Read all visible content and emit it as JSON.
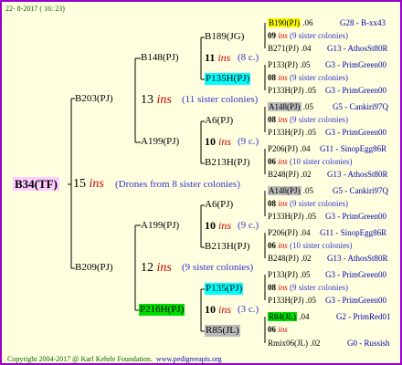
{
  "header": {
    "date_text": "22-  8-2017 ( 16: 23)"
  },
  "footer": {
    "copyright": "Copyright 2004-2017 @ Karl Kehrle Foundation.",
    "website": "www.pedigreeapis.org"
  },
  "colors": {
    "border": "#9900cc",
    "background": "#ffffe0",
    "yellow": "#ffff00",
    "cyan": "#00ffff",
    "green": "#00dd00",
    "gray": "#bbbbbb",
    "root_bg": "#ffccff"
  },
  "root": {
    "label": "B34(TF)",
    "year": "15",
    "ins": "ins",
    "note": "(Drones from 8 sister colonies)"
  },
  "gen1": [
    {
      "label": "B203(PJ)",
      "year": "13",
      "ins": "ins",
      "note": "(11 sister colonies)"
    },
    {
      "label": "B209(PJ)",
      "year": "12",
      "ins": "ins",
      "note": "(9 sister colonies)"
    }
  ],
  "gen2": [
    {
      "label": "B148(PJ)",
      "year": "11",
      "ins": "ins",
      "note": "(8 c.)"
    },
    {
      "label": "A199(PJ)",
      "year": "10",
      "ins": "ins",
      "note": "(9 c.)"
    },
    {
      "label": "A199(PJ)",
      "year": "10",
      "ins": "ins",
      "note": "(9 c.)"
    },
    {
      "label": "P216H(PJ)",
      "year": "10",
      "ins": "ins",
      "note": "(3 c.)"
    }
  ],
  "gen3": [
    {
      "label": "B189(JG)",
      "year": "09",
      "ins": "ins",
      "note": "(9 sister colonies)"
    },
    {
      "label": "P135H(PJ)",
      "year": "08",
      "ins": "ins",
      "note": "(9 sister colonies)"
    },
    {
      "label": "A6(PJ)",
      "year": "08",
      "ins": "ins",
      "note": "(9 sister colonies)"
    },
    {
      "label": "B213H(PJ)",
      "year": "06",
      "ins": "ins",
      "note": "(10 sister colonies)"
    },
    {
      "label": "A6(PJ)",
      "year": "08",
      "ins": "ins",
      "note": "(9 sister colonies)"
    },
    {
      "label": "B213H(PJ)",
      "year": "06",
      "ins": "ins",
      "note": "(10 sister colonies)"
    },
    {
      "label": "P135(PJ)",
      "year": "08",
      "ins": "ins",
      "note": "(9 sister colonies)"
    },
    {
      "label": "R85(JL)",
      "year": "06",
      "ins": "ins",
      "note": ""
    }
  ],
  "gen4": [
    {
      "label": "B190(PJ)",
      "num": ".06",
      "info": "G28 - B-xx43"
    },
    {
      "label": "B271(PJ)",
      "num": ".04",
      "info": "G13 - AthosSt80R"
    },
    {
      "label": "P133(PJ)",
      "num": ".05",
      "info": "G3 - PrimGreen00"
    },
    {
      "label": "P133H(PJ)",
      "num": ".05",
      "info": "G3 - PrimGreen00"
    },
    {
      "label": "A148(PJ)",
      "num": ".05",
      "info": "G5 - Cankiri97Q"
    },
    {
      "label": "P133H(PJ)",
      "num": ".05",
      "info": "G3 - PrimGreen00"
    },
    {
      "label": "P206(PJ)",
      "num": ".04",
      "info": "G11 - SinopEgg86R"
    },
    {
      "label": "B248(PJ)",
      "num": ".02",
      "info": "G13 - AthosSt80R"
    },
    {
      "label": "A148(PJ)",
      "num": ".05",
      "info": "G5 - Cankiri97Q"
    },
    {
      "label": "P133H(PJ)",
      "num": ".05",
      "info": "G3 - PrimGreen00"
    },
    {
      "label": "P206(PJ)",
      "num": ".04",
      "info": "G11 - SinopEgg86R"
    },
    {
      "label": "B248(PJ)",
      "num": ".02",
      "info": "G13 - AthosSt80R"
    },
    {
      "label": "P133(PJ)",
      "num": ".05",
      "info": "G3 - PrimGreen00"
    },
    {
      "label": "P133H(PJ)",
      "num": ".05",
      "info": "G3 - PrimGreen00"
    },
    {
      "label": "R84(JL)",
      "num": ".04",
      "info": "G2 - PrimRed01"
    },
    {
      "label": "Rmix06(JL)",
      "num": ".02",
      "info": "G0 - Russish"
    }
  ]
}
